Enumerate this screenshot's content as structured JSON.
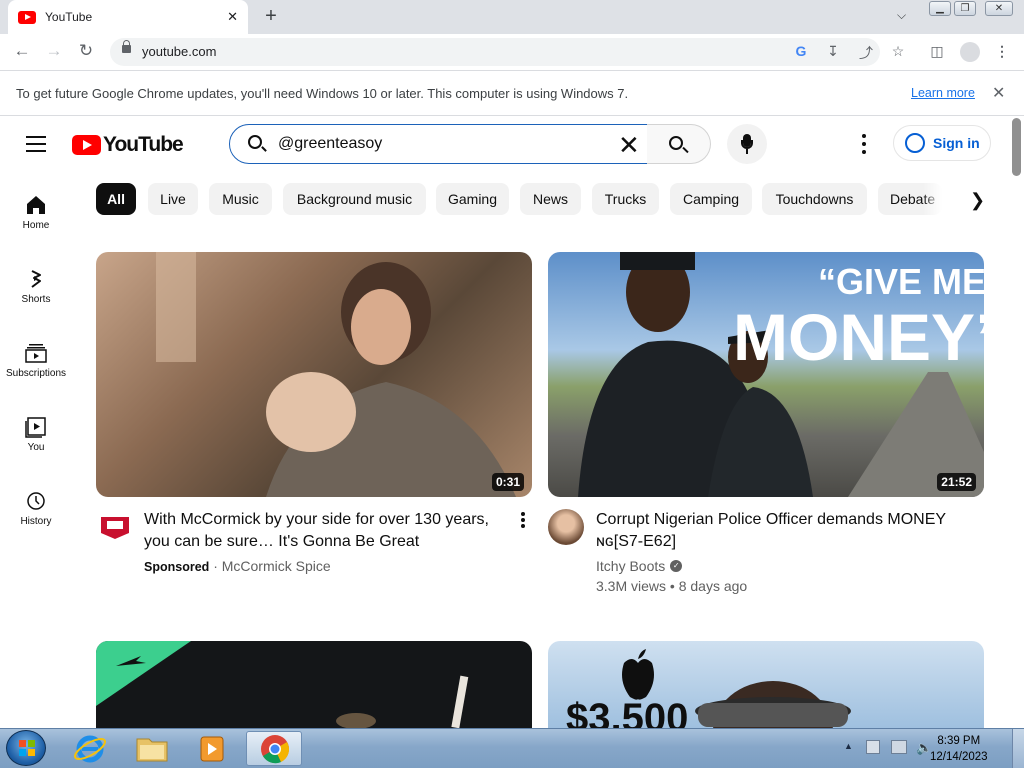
{
  "browser": {
    "tab_title": "YouTube",
    "new_tab_symbol": "+",
    "tab_close_symbol": "✕",
    "url": "youtube.com",
    "info_bar_text": "To get future Google Chrome updates, you'll need Windows 10 or later. This computer is using Windows 7.",
    "learn_more": "Learn more",
    "info_close_symbol": "✕",
    "win_minimize": "▁",
    "win_restore": "❐",
    "win_close": "✕"
  },
  "youtube": {
    "logo_text": "YouTube",
    "search_value": "@greenteasoy",
    "sign_in": "Sign in",
    "sidebar": [
      {
        "label": "Home",
        "icon": "home-icon"
      },
      {
        "label": "Shorts",
        "icon": "shorts-icon"
      },
      {
        "label": "Subscriptions",
        "icon": "subscriptions-icon"
      },
      {
        "label": "You",
        "icon": "you-icon"
      },
      {
        "label": "History",
        "icon": "history-icon"
      }
    ],
    "chips": [
      "All",
      "Live",
      "Music",
      "Background music",
      "Gaming",
      "News",
      "Trucks",
      "Camping",
      "Touchdowns",
      "Debate"
    ],
    "videos": [
      {
        "title": "With McCormick by your side for over 130 years, you can be sure… It's Gonna Be Great",
        "duration": "0:31",
        "sponsored": "Sponsored",
        "separator": "·",
        "channel": "McCormick Spice"
      },
      {
        "title": "Corrupt Nigerian Police Officer demands MONEY ɴɢ[S7-E62]",
        "duration": "21:52",
        "channel": "Itchy Boots",
        "stats": "3.3M views • 8 days ago",
        "thumb_overlay_line1": "“GIVE ME",
        "thumb_overlay_line2": "MONEY”"
      }
    ],
    "bottom_thumb_text": "$3,500"
  },
  "taskbar": {
    "time": "8:39 PM",
    "date": "12/14/2023"
  }
}
